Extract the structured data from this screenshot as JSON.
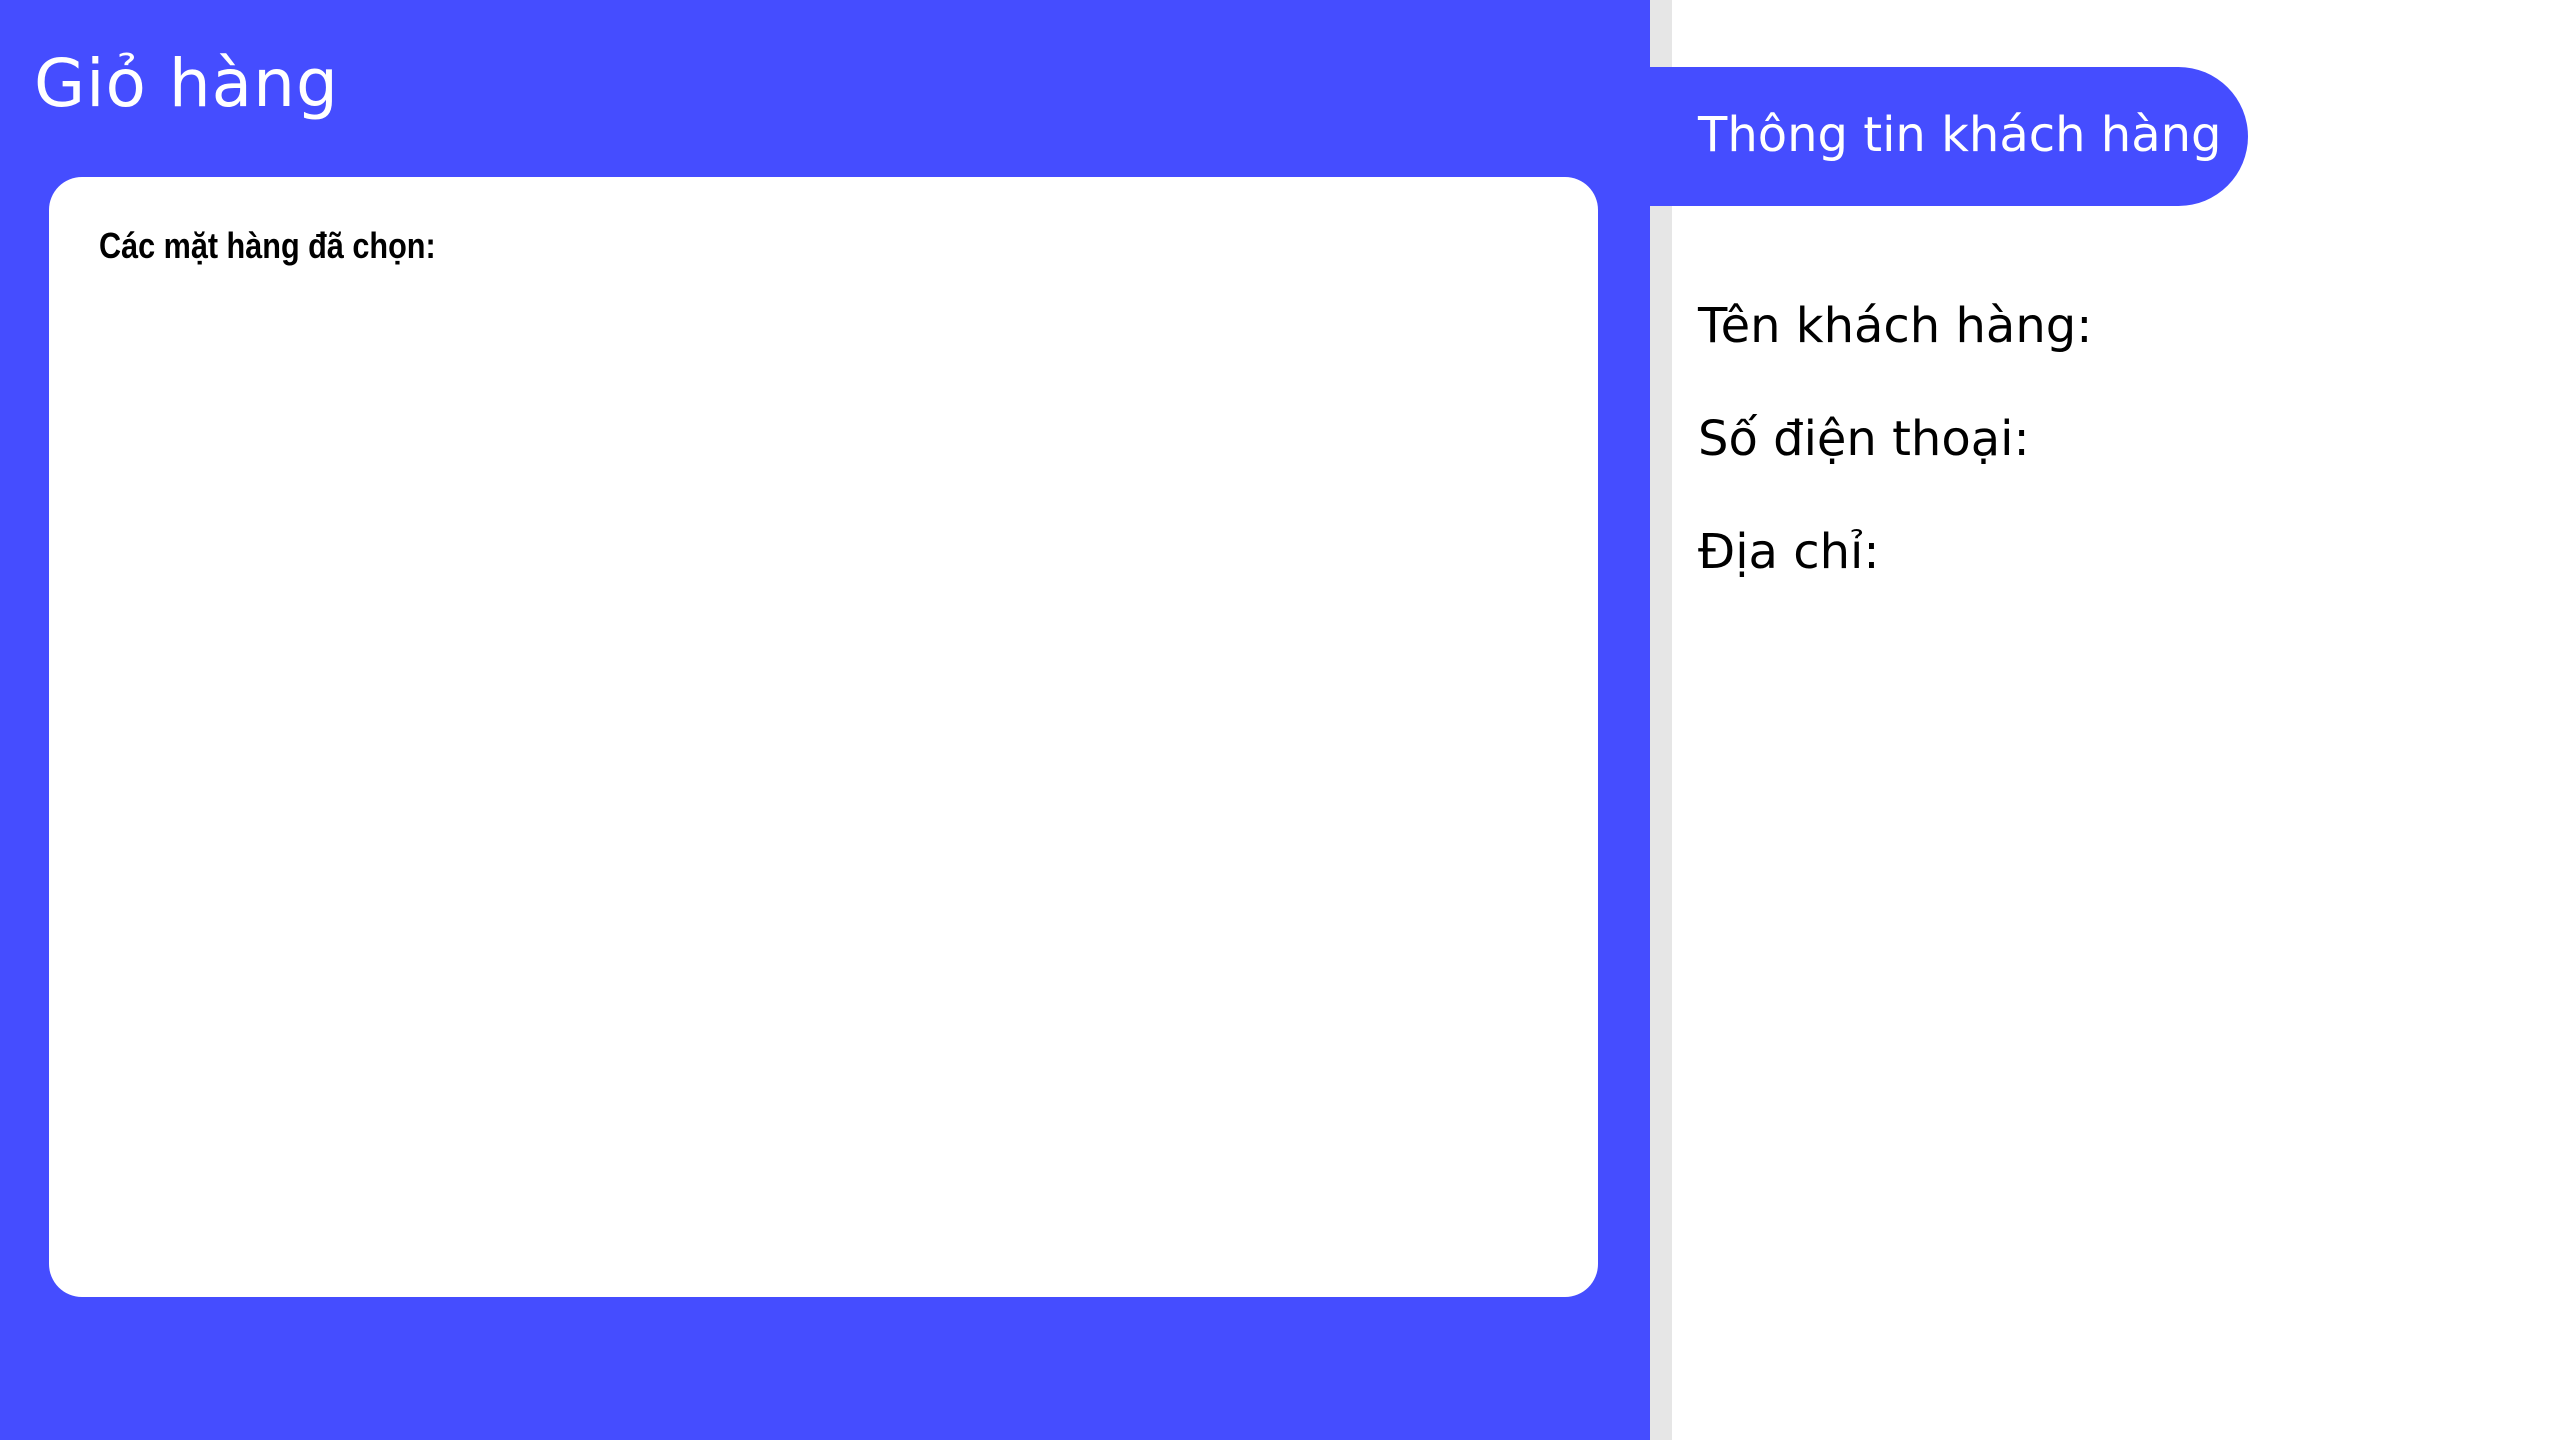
{
  "cart": {
    "title": "Giỏ hàng",
    "selected_items_label": "Các mặt hàng đã chọn:"
  },
  "customer_info": {
    "title": "Thông tin khách hàng",
    "fields": [
      {
        "label": "Tên khách hàng:"
      },
      {
        "label": "Số điện thoại:"
      },
      {
        "label": "Địa chỉ:"
      }
    ]
  },
  "colors": {
    "accent": "#454dff",
    "divider": "#e6e6e6",
    "background": "#ffffff"
  }
}
